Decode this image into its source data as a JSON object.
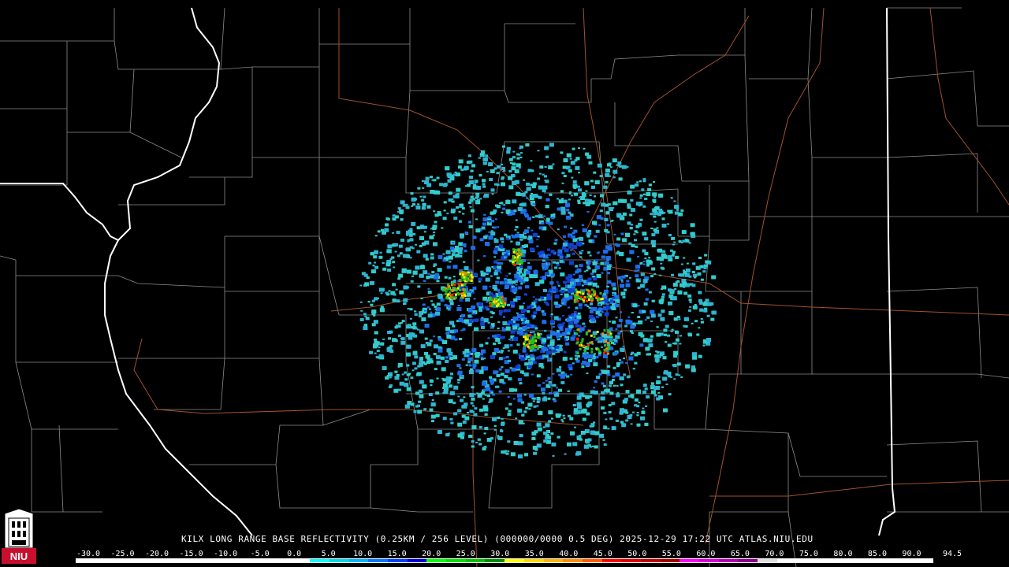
{
  "title": "KILX LONG RANGE BASE REFLECTIVITY (0.25KM / 256 LEVEL) (000000/0000 0.5 DEG) 2025-12-29 17:22 UTC  ATLAS.NIU.EDU",
  "logo": {
    "text": "NIU",
    "icon": "niu-tower-logo-icon",
    "color": "#c8102e"
  },
  "legend": {
    "ticks": [
      "-30.0",
      "-25.0",
      "-20.0",
      "-15.0",
      "-10.0",
      "-5.0",
      "0.0",
      "5.0",
      "10.0",
      "15.0",
      "20.0",
      "25.0",
      "30.0",
      "35.0",
      "40.0",
      "45.0",
      "50.0",
      "55.0",
      "60.0",
      "65.0",
      "70.0",
      "75.0",
      "80.0",
      "85.0",
      "90.0",
      "94.5"
    ],
    "colors": [
      "#ffffff",
      "#ffffff",
      "#ffffff",
      "#ffffff",
      "#ffffff",
      "#ffffff",
      "#ffffff",
      "#ffffff",
      "#ffffff",
      "#ffffff",
      "#ffffff",
      "#ffffff",
      "#00ffff",
      "#00d8e8",
      "#00b4ff",
      "#0078ff",
      "#0040ff",
      "#0000d8",
      "#00ff00",
      "#00e000",
      "#00c000",
      "#008c00",
      "#ffff00",
      "#ffd800",
      "#ffb400",
      "#ff8c00",
      "#ff5a00",
      "#ff0000",
      "#e00000",
      "#c00000",
      "#a00000",
      "#ff00ff",
      "#d800d8",
      "#b400b4",
      "#8c008c",
      "#e0e0e0",
      "#ffffff",
      "#ffffff",
      "#ffffff",
      "#ffffff",
      "#ffffff",
      "#ffffff",
      "#ffffff",
      "#ffffff"
    ]
  },
  "map": {
    "radar_site": "KILX",
    "colors": {
      "state_border": "#ffffff",
      "county_border": "#8c8c8c",
      "highway": "#a0522d",
      "background": "#000000"
    }
  },
  "echo_colors": {
    "light": "#33cccc",
    "light_alt": "#2fb5d0",
    "moderate": "#1e6ee8",
    "strong": "#1040d0",
    "green": "#22c022",
    "yellow": "#ffee00",
    "orange": "#ff8800",
    "red": "#ff2200"
  }
}
